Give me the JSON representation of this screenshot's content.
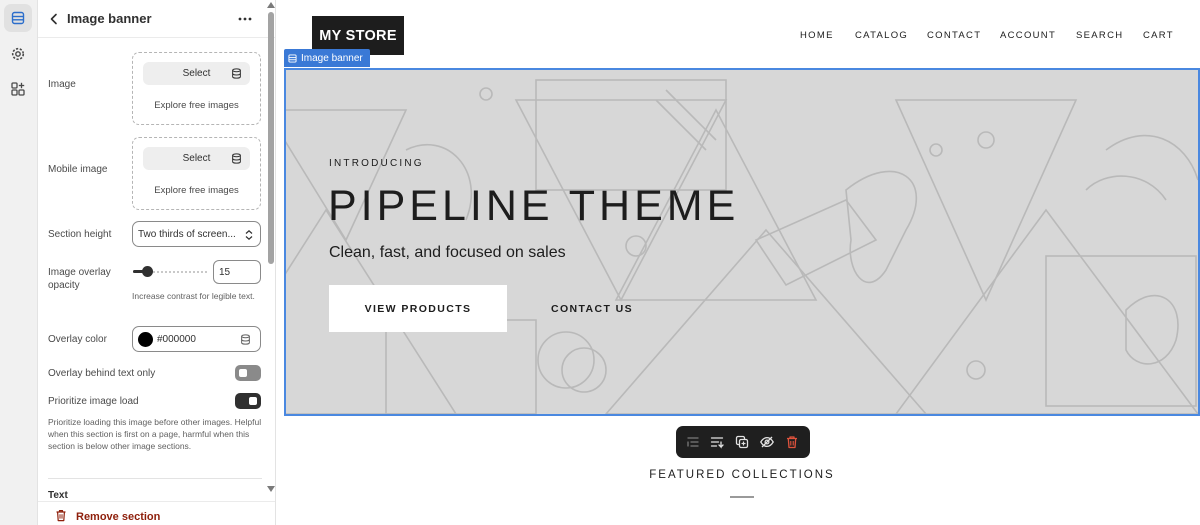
{
  "panel": {
    "title": "Image banner",
    "image": {
      "label": "Image",
      "select": "Select",
      "explore": "Explore free images"
    },
    "mobile_image": {
      "label": "Mobile image",
      "select": "Select",
      "explore": "Explore free images"
    },
    "section_height": {
      "label": "Section height",
      "value": "Two thirds of screen..."
    },
    "overlay_opacity": {
      "label_line1": "Image overlay",
      "label_line2": "opacity",
      "value": "15",
      "help": "Increase contrast for legible text."
    },
    "overlay_color": {
      "label": "Overlay color",
      "value": "#000000"
    },
    "overlay_behind_text": {
      "label": "Overlay behind text only",
      "on": false
    },
    "prioritize": {
      "label": "Prioritize image load",
      "on": true,
      "help": "Prioritize loading this image before other images. Helpful when this section is first on a page, harmful when this section is below other image sections."
    },
    "next_group": "Text",
    "remove": "Remove section"
  },
  "store": {
    "logo": "MY STORE",
    "nav": [
      "HOME",
      "CATALOG",
      "CONTACT",
      "ACCOUNT",
      "SEARCH",
      "CART"
    ]
  },
  "banner": {
    "tag": "Image banner",
    "intro": "INTRODUCING",
    "headline": "PIPELINE THEME",
    "subhead": "Clean, fast, and focused on sales",
    "primary_button": "VIEW PRODUCTS",
    "secondary_button": "CONTACT US"
  },
  "featured": {
    "title": "FEATURED COLLECTIONS"
  },
  "colors": {
    "accent": "#3a79d6",
    "banner_bg": "#d7d7d7",
    "danger": "#8e1f0b",
    "toolbar_bg": "#1f1f1f"
  }
}
